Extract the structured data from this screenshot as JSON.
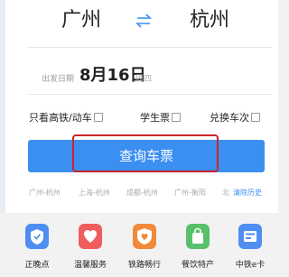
{
  "route": {
    "from": "广州",
    "to": "杭州",
    "swap_icon": "swap-icon"
  },
  "date": {
    "label": "出发日期",
    "value": "8月16日",
    "weekday": "周四"
  },
  "options": {
    "high_speed": "只看高铁/动车",
    "student": "学生票",
    "seat_change": "兑换车次"
  },
  "query_button": "查询车票",
  "history": {
    "items": [
      "广州-杭州",
      "上海-杭州",
      "成都-杭州",
      "广州-衡阳",
      "北"
    ],
    "clear": "清除历史"
  },
  "services": [
    {
      "label": "正晚点",
      "icon": "clock-shield-icon",
      "color": "#4f8ef0"
    },
    {
      "label": "温馨服务",
      "icon": "heart-icon",
      "color": "#ef5d5d"
    },
    {
      "label": "铁路畅行",
      "icon": "shield-heart-icon",
      "color": "#f08a3a"
    },
    {
      "label": "餐饮特产",
      "icon": "bag-icon",
      "color": "#58c06a"
    },
    {
      "label": "中铁e卡",
      "icon": "card-icon",
      "color": "#4f8ef0"
    }
  ],
  "colors": {
    "accent": "#3b8ff0",
    "highlight_border": "#c8232c"
  }
}
